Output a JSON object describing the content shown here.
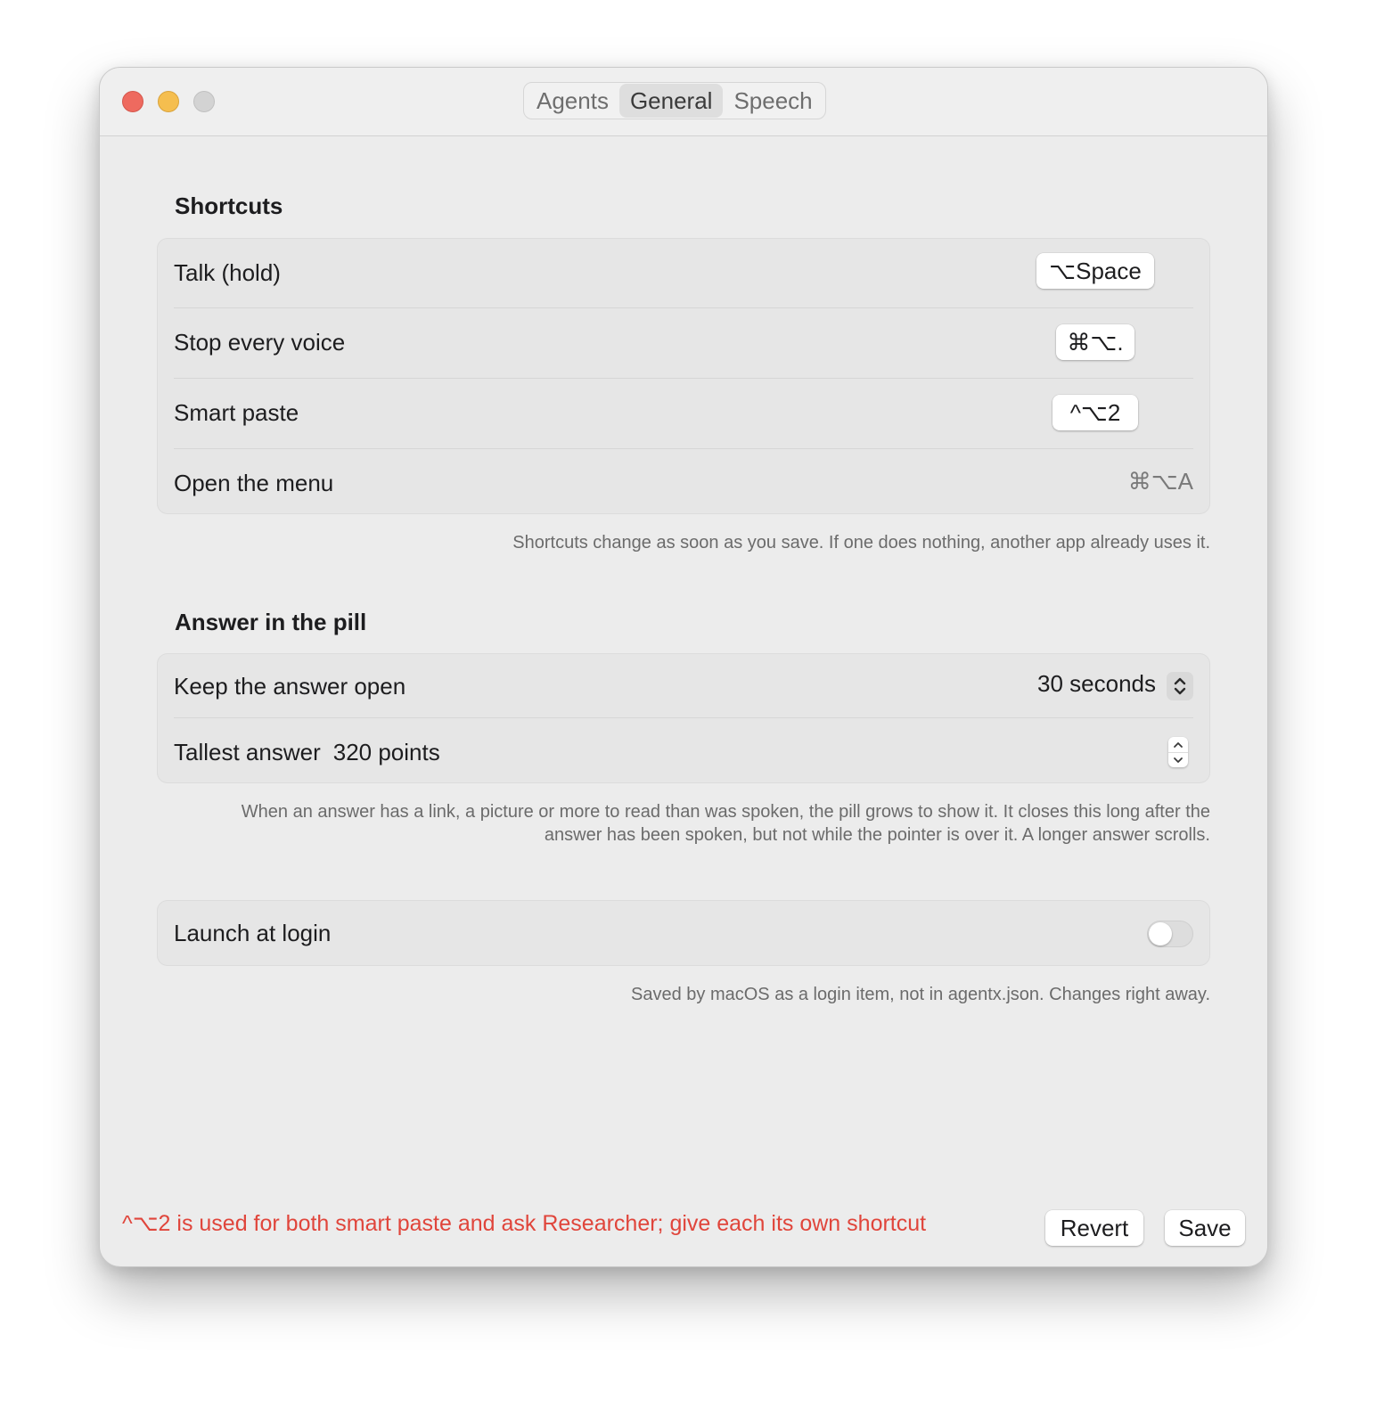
{
  "window": {
    "traffic_lights": [
      "close",
      "minimize",
      "zoom"
    ]
  },
  "tabs": [
    {
      "label": "Agents",
      "active": false
    },
    {
      "label": "General",
      "active": true
    },
    {
      "label": "Speech",
      "active": false
    }
  ],
  "shortcuts": {
    "title": "Shortcuts",
    "rows": [
      {
        "label": "Talk (hold)",
        "shortcut": "⌥Space"
      },
      {
        "label": "Stop every voice",
        "shortcut": "⌘⌥."
      },
      {
        "label": "Smart paste",
        "shortcut": "^⌥2"
      },
      {
        "label": "Open the menu",
        "shortcut": "⌘⌥A"
      }
    ],
    "footnote": "Shortcuts change as soon as you save. If one does nothing, another app already uses it."
  },
  "pill": {
    "title": "Answer in the pill",
    "keep_open_label": "Keep the answer open",
    "keep_open_value": "30 seconds",
    "tallest_label": "Tallest answer",
    "tallest_value": "320 points",
    "footnote_line1": "When an answer has a link, a picture or more to read than was spoken, the pill grows to show it. It closes this long after the",
    "footnote_line2": "answer has been spoken, but not while the pointer is over it. A longer answer scrolls."
  },
  "login": {
    "label": "Launch at login",
    "enabled": false,
    "footnote": "Saved by macOS as a login item, not in agentx.json. Changes right away."
  },
  "footer": {
    "error": "^⌥2 is used for both smart paste and ask Researcher; give each its own shortcut",
    "revert_label": "Revert",
    "save_label": "Save"
  },
  "colors": {
    "error": "#e0453b",
    "close": "#ee6a5f",
    "minimize": "#f5be4f",
    "zoom": "#d3d3d3"
  }
}
